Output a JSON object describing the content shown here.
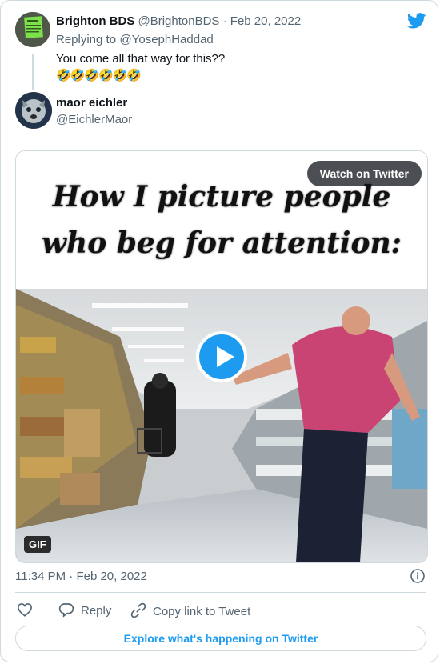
{
  "reply_tweet": {
    "author_name": "Brighton BDS",
    "handle": "@BrightonBDS",
    "separator": "·",
    "date": "Feb 20, 2022",
    "replying_prefix": "Replying to",
    "replying_to": "@YosephHaddad",
    "text": "You come all that way for this??",
    "emoji": "🤣🤣🤣🤣🤣🤣"
  },
  "main_tweet": {
    "author_name": "maor eichler",
    "handle": "@EichlerMaor",
    "media": {
      "caption": "How I picture people who beg for attention:",
      "watch_label": "Watch on Twitter",
      "badge": "GIF"
    },
    "time": "11:34 PM",
    "separator": "·",
    "date": "Feb 20, 2022"
  },
  "actions": {
    "reply_label": "Reply",
    "copy_label": "Copy link to Tweet"
  },
  "footer": {
    "explore_label": "Explore what's happening on Twitter"
  },
  "colors": {
    "accent": "#1d9bf0",
    "muted_text": "#536471",
    "border": "#cfd9de"
  }
}
